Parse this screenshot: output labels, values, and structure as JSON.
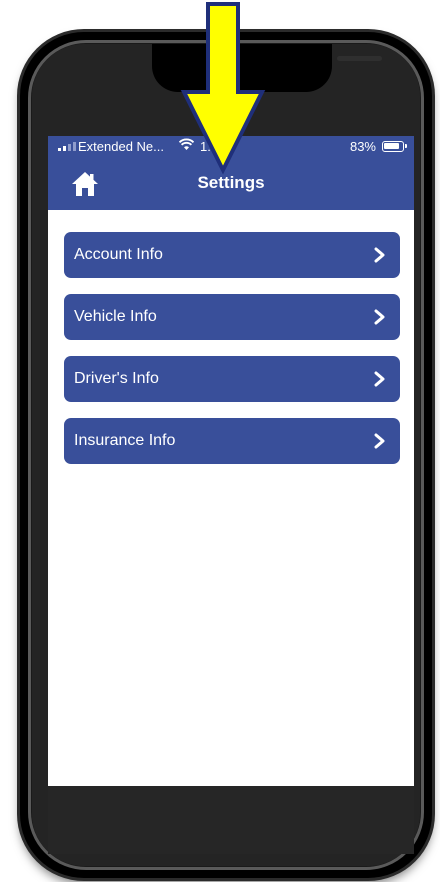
{
  "status_bar": {
    "carrier": "Extended Ne...",
    "time": "1:  PM",
    "battery": "83%",
    "wifi_icon": "wifi-icon"
  },
  "nav": {
    "title": "Settings",
    "home_icon": "home-icon"
  },
  "menu": {
    "items": [
      {
        "label": "Account Info"
      },
      {
        "label": "Vehicle Info"
      },
      {
        "label": "Driver's Info"
      },
      {
        "label": "Insurance Info"
      }
    ]
  },
  "colors": {
    "brand": "#394f9a",
    "highlight_arrow": "#ffff00",
    "arrow_outline": "#1f2f7a"
  }
}
